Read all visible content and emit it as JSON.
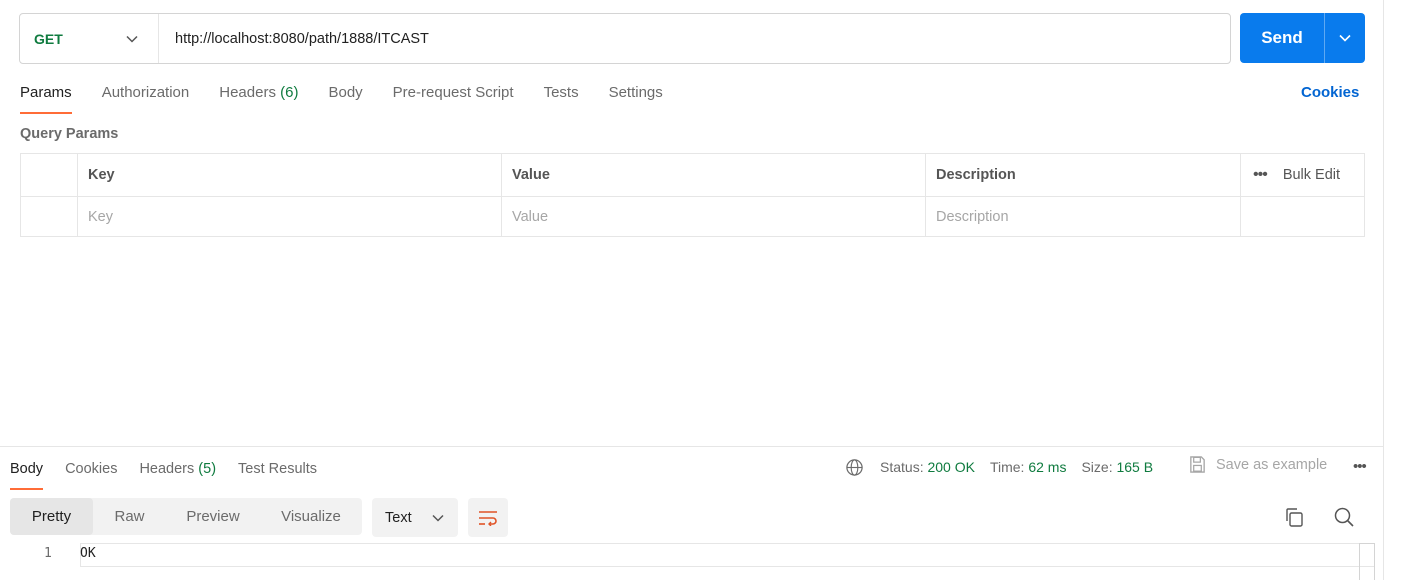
{
  "request": {
    "method": "GET",
    "url": "http://localhost:8080/path/1888/ITCAST",
    "send_label": "Send"
  },
  "request_tabs": [
    {
      "label": "Params",
      "count": "",
      "active": true
    },
    {
      "label": "Authorization",
      "count": "",
      "active": false
    },
    {
      "label": "Headers",
      "count": "(6)",
      "active": false
    },
    {
      "label": "Body",
      "count": "",
      "active": false
    },
    {
      "label": "Pre-request Script",
      "count": "",
      "active": false
    },
    {
      "label": "Tests",
      "count": "",
      "active": false
    },
    {
      "label": "Settings",
      "count": "",
      "active": false
    }
  ],
  "cookies_link": "Cookies",
  "query_params": {
    "title": "Query Params",
    "columns": [
      "Key",
      "Value",
      "Description"
    ],
    "bulk_edit": "Bulk Edit",
    "placeholders": {
      "key": "Key",
      "value": "Value",
      "description": "Description"
    }
  },
  "response_tabs": [
    {
      "label": "Body",
      "count": "",
      "active": true
    },
    {
      "label": "Cookies",
      "count": "",
      "active": false
    },
    {
      "label": "Headers",
      "count": "(5)",
      "active": false
    },
    {
      "label": "Test Results",
      "count": "",
      "active": false
    }
  ],
  "response_meta": {
    "status_label": "Status:",
    "status_value": "200 OK",
    "time_label": "Time:",
    "time_value": "62 ms",
    "size_label": "Size:",
    "size_value": "165 B",
    "save_example": "Save as example"
  },
  "view_modes": [
    "Pretty",
    "Raw",
    "Preview",
    "Visualize"
  ],
  "format": "Text",
  "body_lines": [
    {
      "num": "1",
      "text": "OK"
    }
  ],
  "colors": {
    "accent_orange": "#ff6c37",
    "send_blue": "#097bed",
    "success_green": "#0f7b3f",
    "link_blue": "#0265d2"
  }
}
